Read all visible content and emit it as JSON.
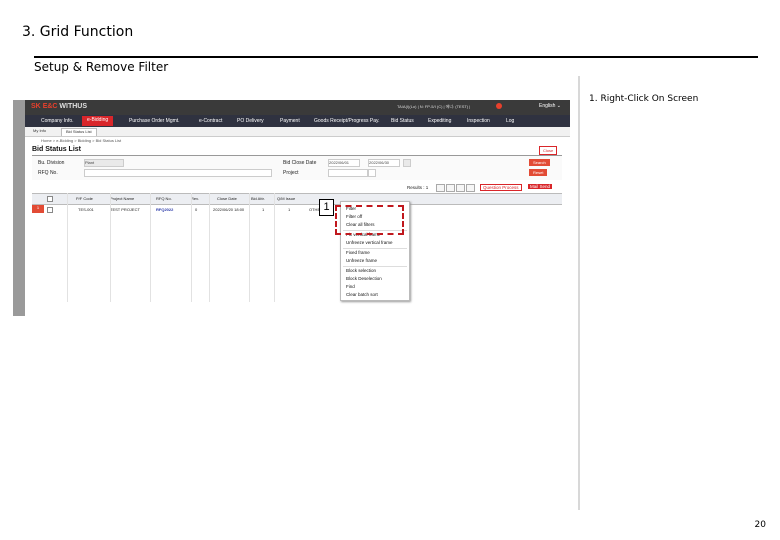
{
  "page": {
    "title": "3. Grid Function",
    "section": "Setup & Remove Filter",
    "instruction": "1. Right-Click On Screen",
    "page_number": "20"
  },
  "app": {
    "logo_brand": "SK",
    "logo_name": "E&C",
    "logo_sub": "WITHUS",
    "user_info": "TA/A(I)(Lo) | N: FP-5/I (C) | 에너: (TEST) |",
    "home_label": "주관",
    "language": "English",
    "menu": [
      "Company Info.",
      "e-Bidding",
      "Purchase Order Mgmt.",
      "e-Contract",
      "PO Delivery",
      "Payment",
      "Goods Receipt/Progress Pay.",
      "Bid Status",
      "Expediting",
      "Inspection",
      "Log"
    ],
    "active_menu_index": 1,
    "tabs": [
      "My Info",
      "Bid Status List"
    ],
    "breadcrumb": "Home > e-Bidding > Bidding > Bid Status List",
    "list_title": "Bid Status List",
    "close_label": "Close"
  },
  "search": {
    "bu_division_label": "Bu. Division",
    "bu_division_value": "Plant",
    "rfq_no_label": "RFQ No.",
    "bid_close_date_label": "Bid Close Date",
    "date_from": "2022/06/01",
    "date_to": "2022/06/30",
    "project_label": "Project",
    "search_button": "Search",
    "reset_button": "Reset"
  },
  "grid": {
    "results_label": "Results : 1",
    "question_process": "Question Process",
    "mail_send": "Mail Send",
    "headers": [
      "P/F Code",
      "Project Name",
      "RFQ No.",
      "Rev.",
      "Close Date",
      "Bid Attr.",
      "Q/M Issue"
    ],
    "row": {
      "num": "1",
      "pf_code": "TES-001",
      "project_name": "TEST PROJECT",
      "rfq_no": "RFQ2022",
      "rev": "0",
      "close_date": "2022/06/20 18:00",
      "bid_attr": "1",
      "qm_issue": "1",
      "extra": "OTHERS"
    }
  },
  "context_menu": {
    "items": [
      "Filter",
      "Filter off",
      "Clear all filters",
      "Fix vertical frame",
      "Unfreeze vertical frame",
      "Fixed frame",
      "Unfreeze frame",
      "Block selection",
      "Block Deselection",
      "Find",
      "Clear batch sort"
    ]
  },
  "step_marker": "1",
  "colors": {
    "accent_red": "#d9262a",
    "menubar": "#2f3240",
    "highlight": "#c0181d"
  }
}
